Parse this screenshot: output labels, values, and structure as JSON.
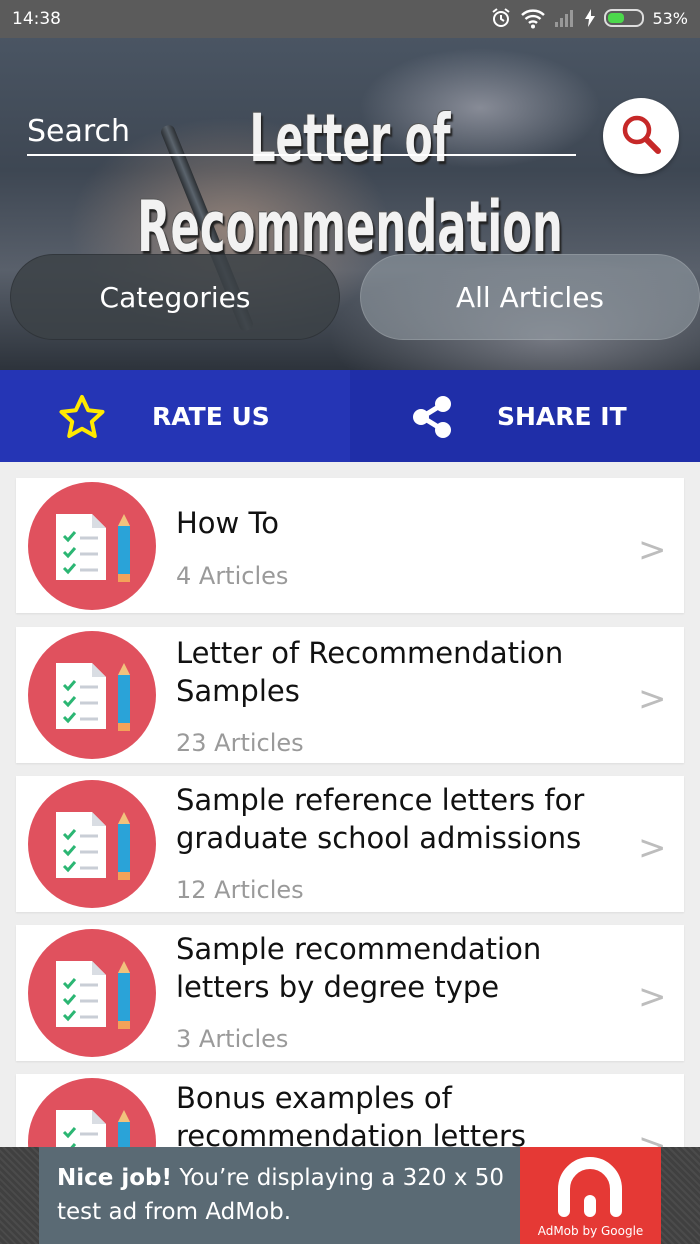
{
  "status_bar": {
    "time": "14:38",
    "battery_pct": "53%",
    "battery_level": 0.53
  },
  "header": {
    "banner_line1": "Letter of",
    "banner_line2": "Recommendation",
    "search_placeholder": "Search",
    "categories_label": "Categories",
    "all_articles_label": "All Articles"
  },
  "actions": {
    "rate_label": "RATE US",
    "share_label": "SHARE IT"
  },
  "items": [
    {
      "title": "How To",
      "count": "4 Articles"
    },
    {
      "title": "Letter of Recommendation Samples",
      "count": "23 Articles"
    },
    {
      "title": "Sample reference letters for graduate school admissions",
      "count": "12 Articles"
    },
    {
      "title": "Sample recommendation letters by degree type",
      "count": "3 Articles"
    },
    {
      "title": "Bonus examples of recommendation letters",
      "count": ""
    }
  ],
  "chevron": ">",
  "ad": {
    "headline": "Nice job!",
    "body": " You’re displaying a 320 x 50 test ad from AdMob.",
    "logo_caption": "AdMob by Google"
  },
  "colors": {
    "action_blue": "#2535b5",
    "icon_red": "#e0515e",
    "ad_red": "#e53935"
  }
}
